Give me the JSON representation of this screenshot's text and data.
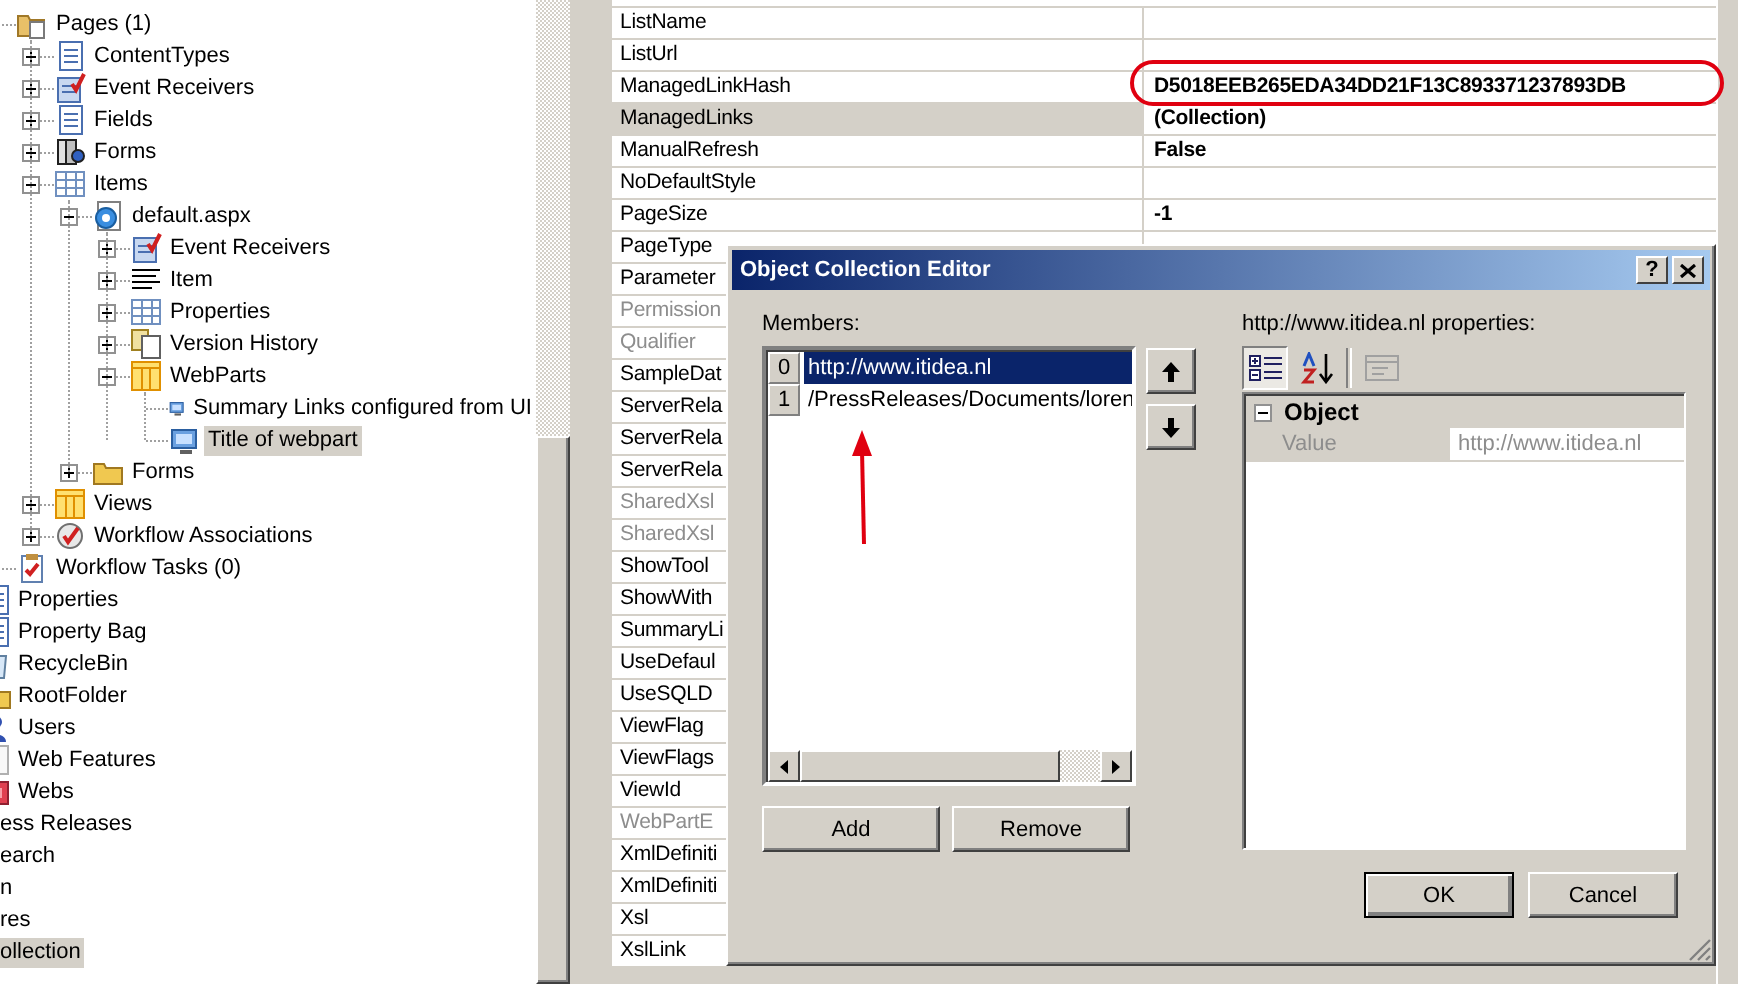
{
  "tree": {
    "lists_branch": [
      {
        "label": "Pages (1)",
        "kind": "pages",
        "selected": false,
        "children": [
          {
            "label": "ContentTypes",
            "kind": "list",
            "expanded": false,
            "selected": false
          },
          {
            "label": "Event Receivers",
            "kind": "receivers",
            "expanded": false,
            "selected": false
          },
          {
            "label": "Fields",
            "kind": "list",
            "expanded": false,
            "selected": false
          },
          {
            "label": "Forms",
            "kind": "forms",
            "expanded": false,
            "selected": false
          },
          {
            "label": "Items",
            "kind": "table",
            "expanded": true,
            "selected": false,
            "children": [
              {
                "label": "default.aspx",
                "kind": "page",
                "expanded": true,
                "selected": false,
                "children": [
                  {
                    "label": "Event Receivers",
                    "kind": "receivers",
                    "expanded": false,
                    "selected": false
                  },
                  {
                    "label": "Item",
                    "kind": "lines",
                    "expanded": false,
                    "selected": false
                  },
                  {
                    "label": "Properties",
                    "kind": "table",
                    "expanded": false,
                    "selected": false
                  },
                  {
                    "label": "Version History",
                    "kind": "history",
                    "expanded": false,
                    "selected": false
                  },
                  {
                    "label": "WebParts",
                    "kind": "columns",
                    "expanded": true,
                    "selected": false,
                    "children": [
                      {
                        "label": "Summary Links configured from UI",
                        "kind": "webpart",
                        "selected": false
                      },
                      {
                        "label": "Title of webpart",
                        "kind": "webpart",
                        "selected": true
                      }
                    ]
                  }
                ]
              },
              {
                "label": "Forms",
                "kind": "folder",
                "expanded": false,
                "selected": false
              }
            ]
          },
          {
            "label": "Views",
            "kind": "columns",
            "expanded": false,
            "selected": false
          },
          {
            "label": "Workflow Associations",
            "kind": "workflow",
            "expanded": false,
            "selected": false
          }
        ]
      },
      {
        "label": "Workflow Tasks (0)",
        "kind": "tasks",
        "selected": false
      }
    ],
    "web_branch": [
      {
        "label": "Properties",
        "kind": "list",
        "selected": false
      },
      {
        "label": "Property Bag",
        "kind": "list",
        "selected": false
      },
      {
        "label": "RecycleBin",
        "kind": "recycle",
        "selected": false
      },
      {
        "label": "RootFolder",
        "kind": "folder",
        "selected": false
      },
      {
        "label": "Users",
        "kind": "users",
        "selected": false
      },
      {
        "label": "Web Features",
        "kind": "features",
        "selected": false
      },
      {
        "label": "Webs",
        "kind": "webs",
        "selected": false
      }
    ],
    "site_branch": [
      {
        "label": "ess Releases",
        "selected": false
      },
      {
        "label": "earch",
        "selected": false
      },
      {
        "label": "n",
        "selected": false
      },
      {
        "label": "res",
        "selected": false
      },
      {
        "label": "ollection",
        "selected": true
      }
    ]
  },
  "property_grid": {
    "rows": [
      {
        "name": "ListName",
        "selected": false,
        "disabled": false
      },
      {
        "name": "ListUrl",
        "selected": false,
        "disabled": false
      },
      {
        "name": "ManagedLinkHash",
        "value": "D5018EEB265EDA34DD21F13C893371237893DB",
        "modified": true,
        "selected": false,
        "disabled": false,
        "circled": true
      },
      {
        "name": "ManagedLinks",
        "value": "(Collection)",
        "modified": true,
        "selected": true,
        "disabled": false
      },
      {
        "name": "ManualRefresh",
        "value": "False",
        "modified": true,
        "selected": false,
        "disabled": false
      },
      {
        "name": "NoDefaultStyle",
        "selected": false,
        "disabled": false
      },
      {
        "name": "PageSize",
        "value": "-1",
        "modified": true,
        "selected": false,
        "disabled": false
      },
      {
        "name": "PageType",
        "selected": false,
        "disabled": false
      },
      {
        "name": "Parameter",
        "selected": false,
        "disabled": false
      },
      {
        "name": "Permission",
        "selected": false,
        "disabled": true
      },
      {
        "name": "Qualifier",
        "selected": false,
        "disabled": true
      },
      {
        "name": "SampleDat",
        "selected": false,
        "disabled": false
      },
      {
        "name": "ServerRela",
        "selected": false,
        "disabled": false
      },
      {
        "name": "ServerRela",
        "selected": false,
        "disabled": false
      },
      {
        "name": "ServerRela",
        "selected": false,
        "disabled": false
      },
      {
        "name": "SharedXsl",
        "selected": false,
        "disabled": true
      },
      {
        "name": "SharedXsl",
        "selected": false,
        "disabled": true
      },
      {
        "name": "ShowTool",
        "selected": false,
        "disabled": false
      },
      {
        "name": "ShowWith",
        "selected": false,
        "disabled": false
      },
      {
        "name": "SummaryLi",
        "selected": false,
        "disabled": false
      },
      {
        "name": "UseDefaul",
        "selected": false,
        "disabled": false
      },
      {
        "name": "UseSQLD",
        "selected": false,
        "disabled": false
      },
      {
        "name": "ViewFlag",
        "selected": false,
        "disabled": false
      },
      {
        "name": "ViewFlags",
        "selected": false,
        "disabled": false
      },
      {
        "name": "ViewId",
        "selected": false,
        "disabled": false
      },
      {
        "name": "WebPartE",
        "selected": false,
        "disabled": true
      },
      {
        "name": "XmlDefiniti",
        "selected": false,
        "disabled": false
      },
      {
        "name": "XmlDefiniti",
        "selected": false,
        "disabled": false
      },
      {
        "name": "Xsl",
        "selected": false,
        "disabled": false
      },
      {
        "name": "XslLink",
        "selected": false,
        "disabled": false
      }
    ]
  },
  "dialog": {
    "title": "Object Collection Editor",
    "help_button": "?",
    "members_label": "Members:",
    "members": [
      {
        "index": "0",
        "text": "http://www.itidea.nl",
        "selected": true
      },
      {
        "index": "1",
        "text": "/PressReleases/Documents/loren",
        "selected": false
      }
    ],
    "add_button": "Add",
    "remove_button": "Remove",
    "properties_label": "http://www.itidea.nl properties:",
    "toolbar": [
      {
        "kind": "categorized",
        "selected": true,
        "disabled": false
      },
      {
        "kind": "alphabetical",
        "selected": false,
        "disabled": false
      },
      {
        "kind": "property-pages",
        "selected": false,
        "disabled": true
      }
    ],
    "properties": {
      "category": "Object",
      "expanded": true,
      "rows": [
        {
          "name": "Value",
          "value": "http://www.itidea.nl",
          "disabled": true
        }
      ]
    },
    "ok_button": "OK",
    "cancel_button": "Cancel"
  }
}
